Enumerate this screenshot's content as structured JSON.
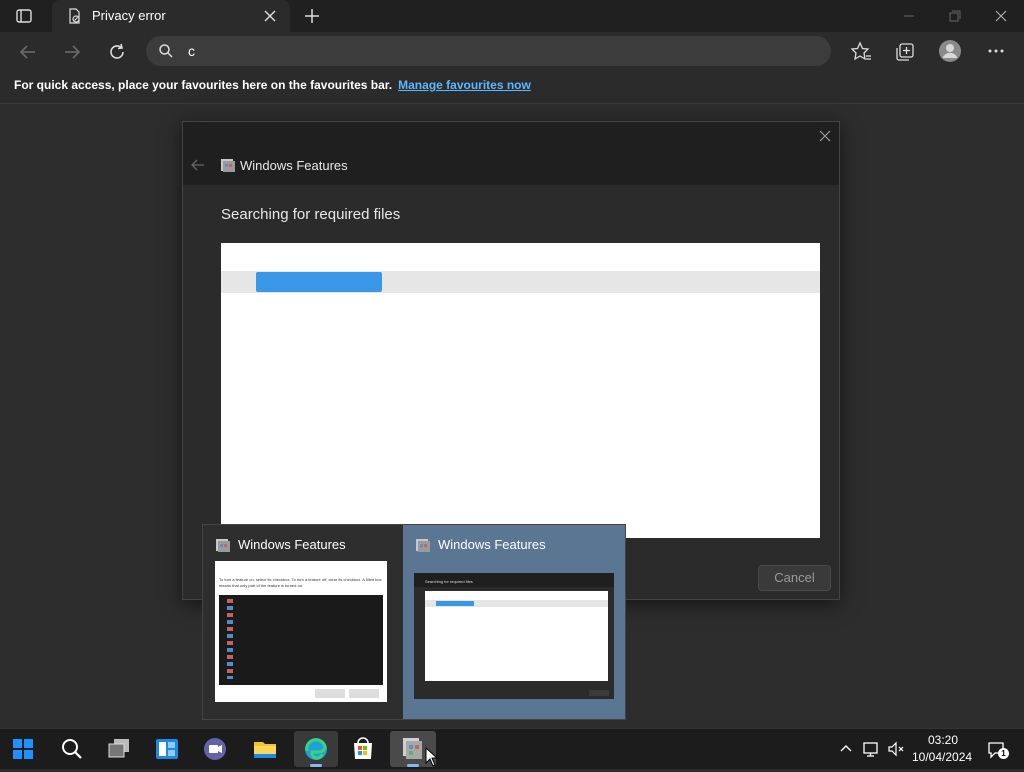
{
  "browser": {
    "tab_title": "Privacy error",
    "address_text": "c",
    "favbar_text": "For quick access, place your favourites here on the favourites bar.",
    "favbar_link": "Manage favourites now"
  },
  "dialog": {
    "title": "Windows Features",
    "heading": "Searching for required files",
    "cancel_label": "Cancel",
    "progress_fraction": 0.21
  },
  "thumbnails": [
    {
      "title": "Windows Features"
    },
    {
      "title": "Windows Features"
    }
  ],
  "thumbnail1_text": {
    "instruction": "To turn a feature on, select its checkbox. To turn a feature off, clear its checkbox. A filled box means that only part of the feature is turned on."
  },
  "thumbnail2_text": {
    "heading": "Searching for required files"
  },
  "taskbar": {
    "time": "03:20",
    "date": "10/04/2024",
    "notification_count": "1"
  },
  "colors": {
    "accent": "#3a96e6",
    "link": "#5cb8ff",
    "selected_thumb": "#5a7693"
  }
}
